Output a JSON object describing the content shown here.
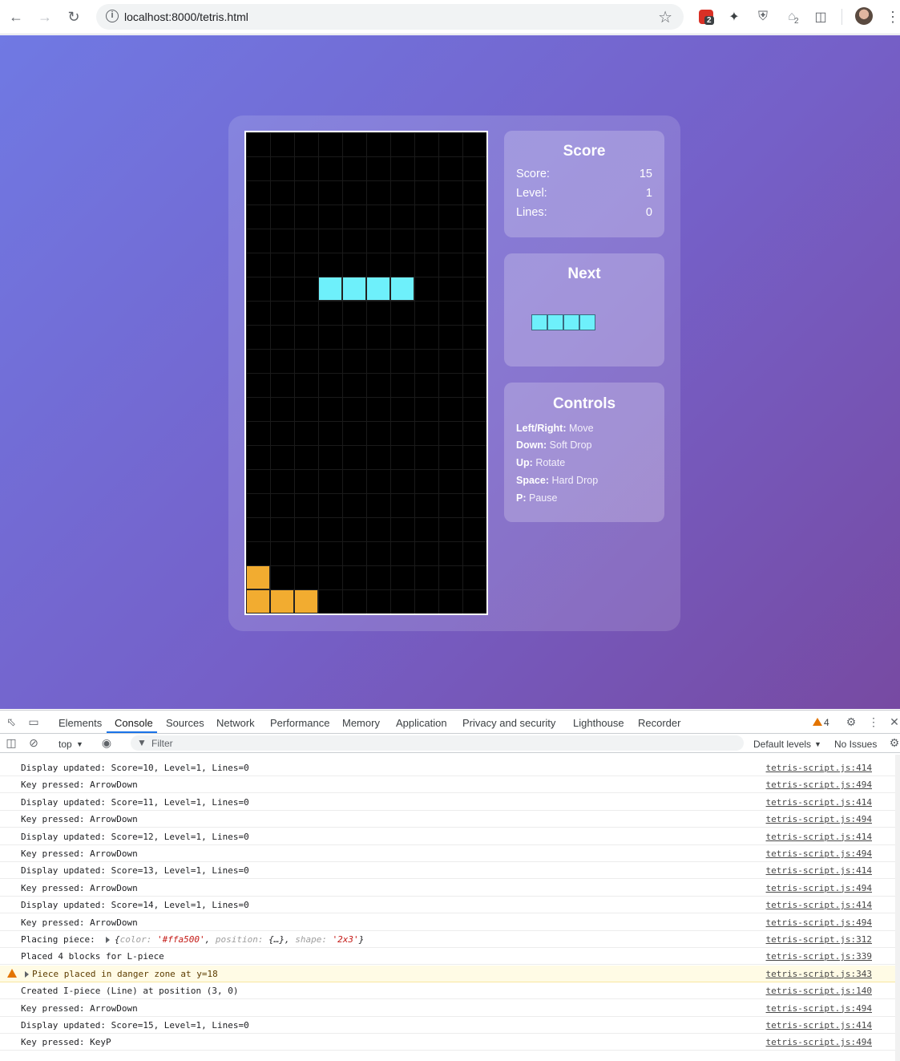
{
  "browser": {
    "url": "localhost:8000/tetris.html",
    "ext_badges": [
      "2",
      "2"
    ]
  },
  "game": {
    "score_panel": {
      "title": "Score",
      "rows": [
        {
          "label": "Score:",
          "value": "15"
        },
        {
          "label": "Level:",
          "value": "1"
        },
        {
          "label": "Lines:",
          "value": "0"
        }
      ]
    },
    "next_panel": {
      "title": "Next"
    },
    "controls_panel": {
      "title": "Controls",
      "rows": [
        {
          "key": "Left/Right:",
          "action": "Move"
        },
        {
          "key": "Down:",
          "action": "Soft Drop"
        },
        {
          "key": "Up:",
          "action": "Rotate"
        },
        {
          "key": "Space:",
          "action": "Hard Drop"
        },
        {
          "key": "P:",
          "action": "Pause"
        }
      ]
    },
    "colors": {
      "i_piece": "#6ef0fb",
      "l_piece": "#f2ac30"
    }
  },
  "devtools": {
    "tabs": [
      "Elements",
      "Console",
      "Sources",
      "Network",
      "Performance",
      "Memory",
      "Application",
      "Privacy and security",
      "Lighthouse",
      "Recorder"
    ],
    "active_tab": "Console",
    "warn_count": "4",
    "context": "top",
    "filter_placeholder": "Filter",
    "levels": "Default levels",
    "issues": "No Issues",
    "logs": [
      {
        "msg": "Display updated: Score=10, Level=1, Lines=0",
        "src": "tetris-script.js:414"
      },
      {
        "msg": "Key pressed: ArrowDown",
        "src": "tetris-script.js:494"
      },
      {
        "msg": "Display updated: Score=11, Level=1, Lines=0",
        "src": "tetris-script.js:414"
      },
      {
        "msg": "Key pressed: ArrowDown",
        "src": "tetris-script.js:494"
      },
      {
        "msg": "Display updated: Score=12, Level=1, Lines=0",
        "src": "tetris-script.js:414"
      },
      {
        "msg": "Key pressed: ArrowDown",
        "src": "tetris-script.js:494"
      },
      {
        "msg": "Display updated: Score=13, Level=1, Lines=0",
        "src": "tetris-script.js:414"
      },
      {
        "msg": "Key pressed: ArrowDown",
        "src": "tetris-script.js:494"
      },
      {
        "msg": "Display updated: Score=14, Level=1, Lines=0",
        "src": "tetris-script.js:414"
      },
      {
        "msg": "Key pressed: ArrowDown",
        "src": "tetris-script.js:494"
      },
      {
        "msg": "Placing piece:",
        "src": "tetris-script.js:312",
        "object": {
          "color_key": "color:",
          "color_val": "'#ffa500'",
          "pos_key": "position:",
          "pos_val": "{…}",
          "shape_key": "shape:",
          "shape_val": "'2x3'"
        }
      },
      {
        "msg": "Placed 4 blocks for L-piece",
        "src": "tetris-script.js:339"
      },
      {
        "msg": "Piece placed in danger zone at y=18",
        "src": "tetris-script.js:343",
        "warn": true
      },
      {
        "msg": "Created I-piece (Line) at position (3, 0)",
        "src": "tetris-script.js:140"
      },
      {
        "msg": "Key pressed: ArrowDown",
        "src": "tetris-script.js:494"
      },
      {
        "msg": "Display updated: Score=15, Level=1, Lines=0",
        "src": "tetris-script.js:414"
      },
      {
        "msg": "Key pressed: KeyP",
        "src": "tetris-script.js:494"
      }
    ]
  }
}
